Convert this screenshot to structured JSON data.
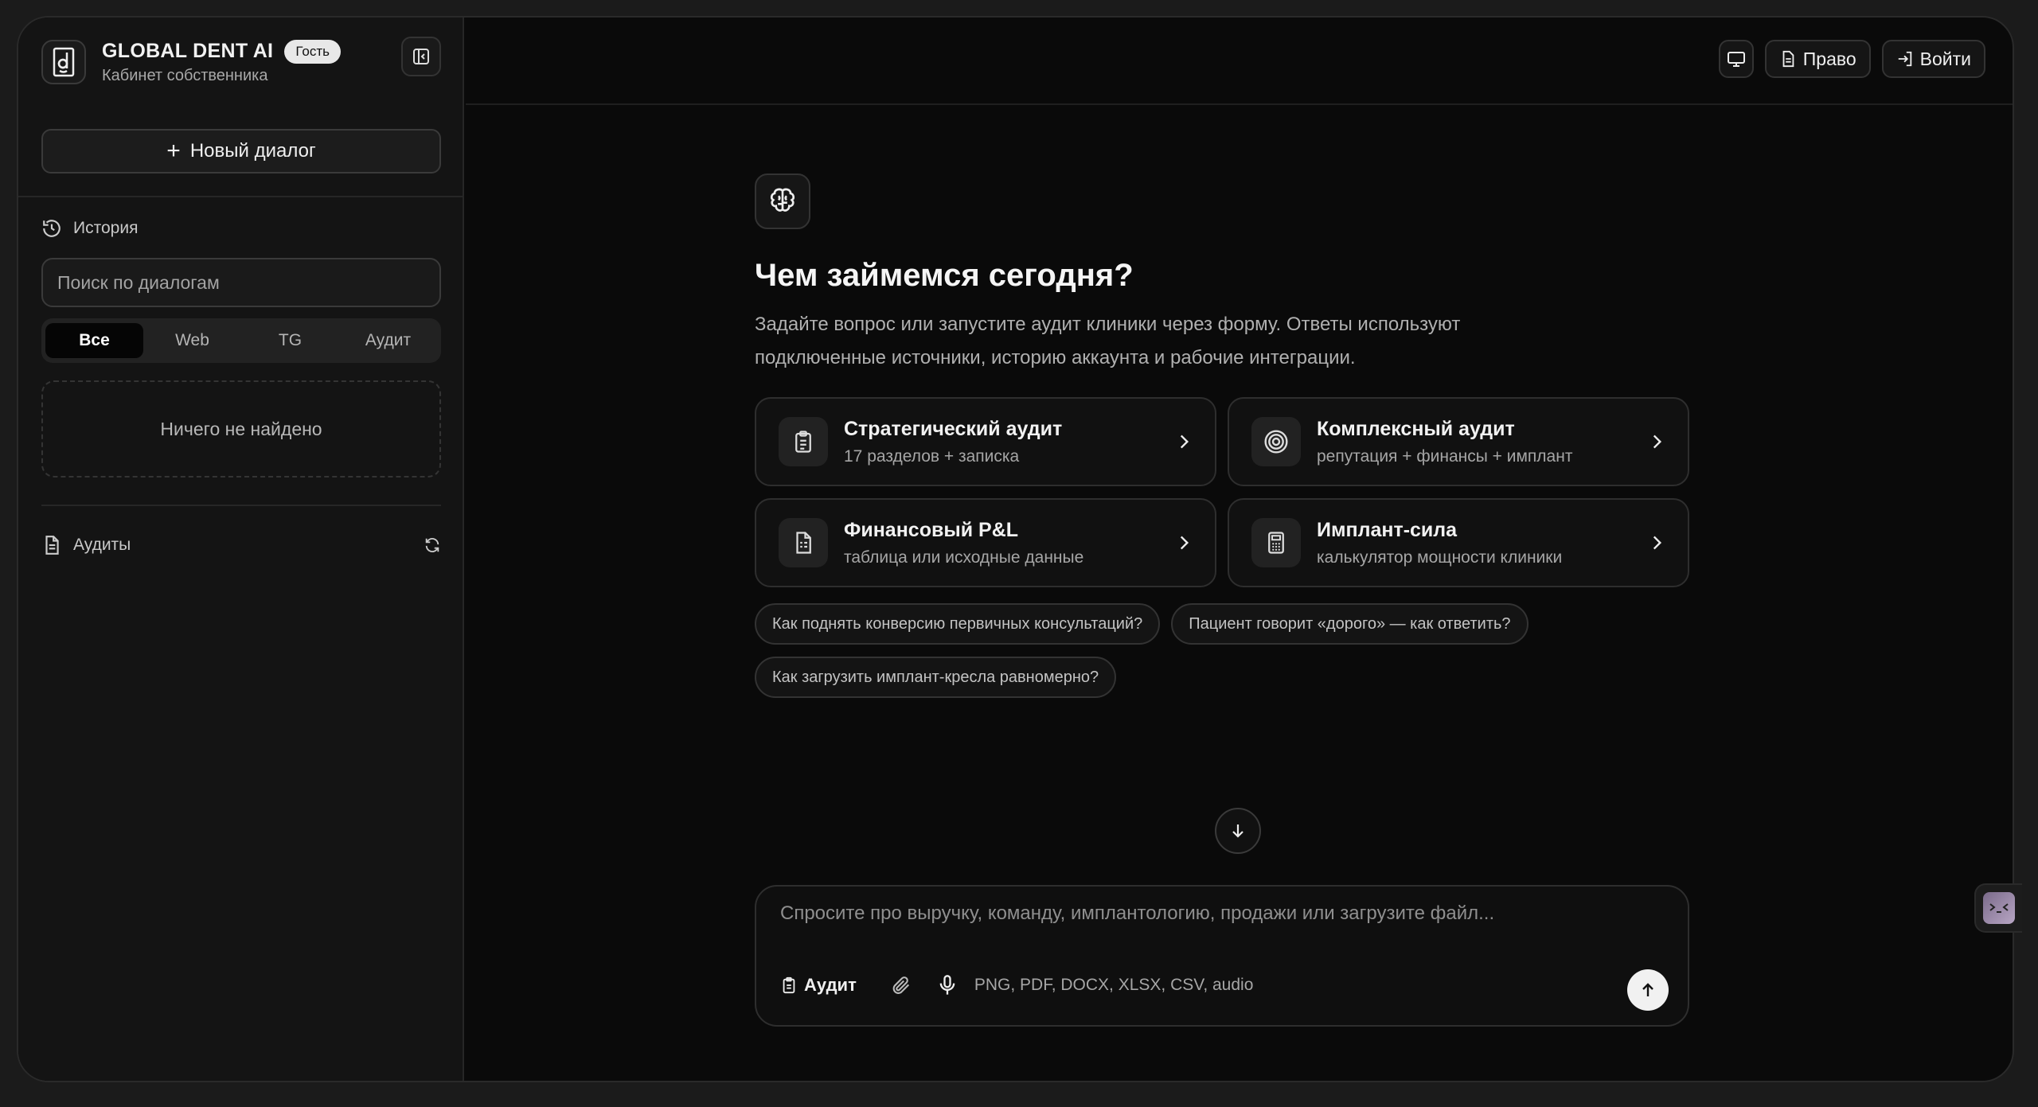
{
  "sidebar": {
    "brand_name": "GLOBAL DENT AI",
    "brand_badge": "Гость",
    "brand_subtitle": "Кабинет собственника",
    "new_chat_label": "Новый диалог",
    "history_label": "История",
    "search_placeholder": "Поиск по диалогам",
    "filters": [
      {
        "label": "Все",
        "active": true
      },
      {
        "label": "Web",
        "active": false
      },
      {
        "label": "TG",
        "active": false
      },
      {
        "label": "Аудит",
        "active": false
      }
    ],
    "empty_text": "Ничего не найдено",
    "audits_label": "Аудиты"
  },
  "header": {
    "law_label": "Право",
    "login_label": "Войти"
  },
  "main": {
    "headline": "Чем займемся сегодня?",
    "lead": "Задайте вопрос или запустите аудит клиники через форму. Ответы используют подключенные источники, историю аккаунта и рабочие интеграции.",
    "cards": [
      {
        "title": "Стратегический аудит",
        "subtitle": "17 разделов + записка",
        "icon": "clipboard-icon"
      },
      {
        "title": "Комплексный аудит",
        "subtitle": "репутация + финансы + имплант",
        "icon": "target-icon"
      },
      {
        "title": "Финансовый P&L",
        "subtitle": "таблица или исходные данные",
        "icon": "spreadsheet-icon"
      },
      {
        "title": "Имплант-сила",
        "subtitle": "калькулятор мощности клиники",
        "icon": "calculator-icon"
      }
    ],
    "suggestions": [
      "Как поднять конверсию первичных консультаций?",
      "Пациент говорит «дорого» — как ответить?",
      "Как загрузить имплант-кресла равномерно?"
    ]
  },
  "composer": {
    "placeholder": "Спросите про выручку, команду, имплантологию, продажи или загрузите файл...",
    "audit_label": "Аудит",
    "formats": "PNG, PDF, DOCX, XLSX, CSV, audio"
  },
  "colors": {
    "background": "#0a0a0a",
    "sidebar": "#141414",
    "accent": "#f1f1f1"
  }
}
